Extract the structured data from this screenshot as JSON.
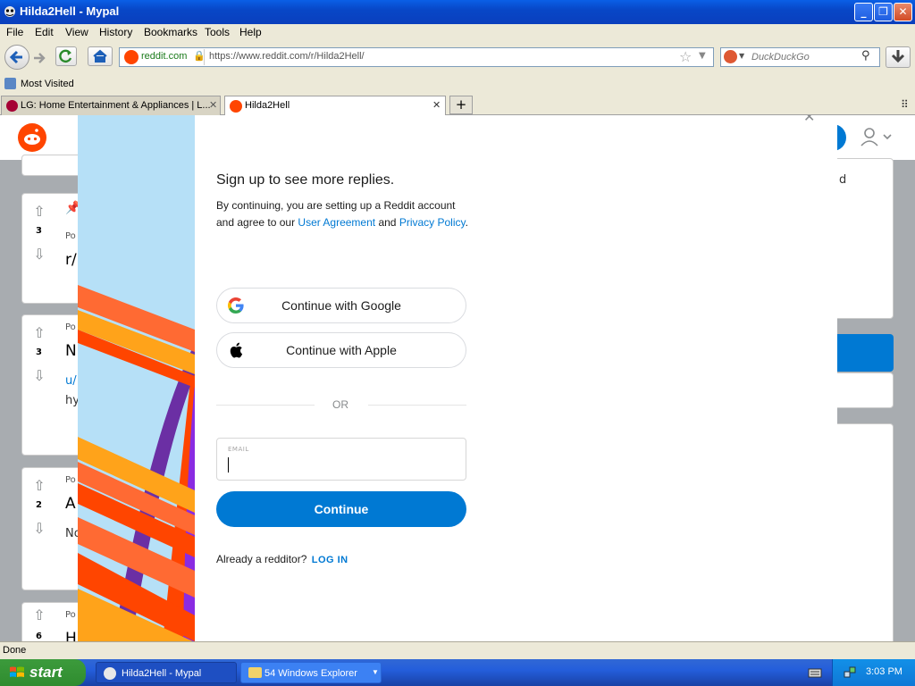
{
  "window": {
    "title": "Hilda2Hell - Mypal",
    "minimize": "_",
    "maximize": "❐",
    "close": "✕"
  },
  "menu": [
    "File",
    "Edit",
    "View",
    "History",
    "Bookmarks",
    "Tools",
    "Help"
  ],
  "nav": {
    "site_badge": "reddit.com",
    "url": "https://www.reddit.com/r/Hilda2Hell/",
    "search_placeholder": "DuckDuckGo"
  },
  "bookmarks": {
    "most_visited": "Most Visited"
  },
  "tabs": [
    {
      "title": "LG: Home Entertainment & Appliances | L...",
      "close": "✕"
    },
    {
      "title": "Hilda2Hell",
      "close": "✕"
    }
  ],
  "new_tab": "+",
  "background": {
    "posts": [
      {
        "score": "3",
        "meta": "Po",
        "title": "r/"
      },
      {
        "score": "3",
        "meta": "Po",
        "title": "N",
        "line2": "u/",
        "line3": "hy"
      },
      {
        "score": "2",
        "meta": "Po",
        "title": "A",
        "line2": "No"
      },
      {
        "score": "6",
        "meta": "Po",
        "title": "H"
      }
    ],
    "right_snippet": "d"
  },
  "modal": {
    "close": "✕",
    "heading": "Sign up to see more replies.",
    "desc_prefix": "By continuing, you are setting up a Reddit account and agree to our ",
    "user_agreement": "User Agreement",
    "desc_and": " and ",
    "privacy_policy": "Privacy Policy",
    "desc_suffix": ".",
    "google_btn": "Continue with Google",
    "apple_btn": "Continue with Apple",
    "or": "OR",
    "email_label": "EMAIL",
    "email_value": "",
    "continue_btn": "Continue",
    "already": "Already a redditor?",
    "login": "LOG IN"
  },
  "status": "Done",
  "taskbar": {
    "start": "start",
    "items": [
      {
        "label": "Hilda2Hell - Mypal"
      },
      {
        "label": "54 Windows Explorer"
      }
    ],
    "clock": "3:03 PM"
  },
  "colors": {
    "accent": "#0079d3",
    "xp_blue": "#245edb",
    "reddit_orange": "#ff4500"
  }
}
